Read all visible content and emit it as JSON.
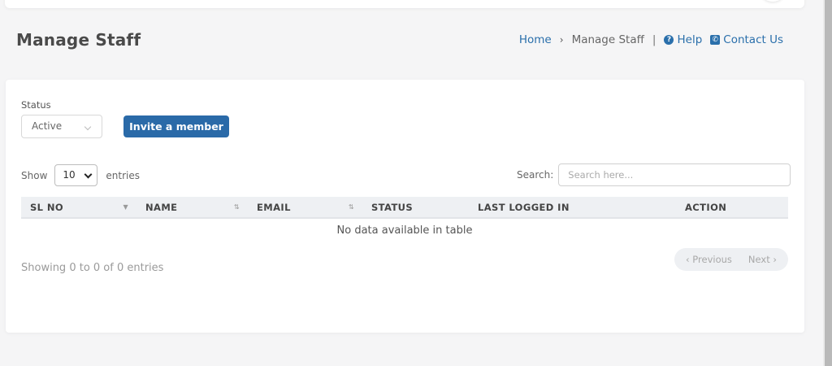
{
  "header": {
    "title": "Manage Staff",
    "breadcrumb": {
      "home": "Home",
      "separator": "›",
      "current": "Manage Staff",
      "divider": "|"
    },
    "help": "Help",
    "contact": "Contact Us"
  },
  "filters": {
    "status_label": "Status",
    "status_value": "Active",
    "invite_button": "Invite a member"
  },
  "table_controls": {
    "show_label": "Show",
    "page_length": "10",
    "entries_label": "entries",
    "search_label": "Search:",
    "search_placeholder": "Search here..."
  },
  "table": {
    "columns": [
      "SL NO",
      "NAME",
      "EMAIL",
      "STATUS",
      "LAST LOGGED IN",
      "ACTION"
    ],
    "empty_message": "No data available in table"
  },
  "footer": {
    "info": "Showing 0 to 0 of 0 entries",
    "previous": "‹ Previous",
    "next": "Next ›"
  },
  "icons": {
    "help": "question-circle-icon",
    "contact": "phone-square-icon"
  },
  "colors": {
    "accent": "#2a6aa8",
    "link": "#2a6fab"
  }
}
